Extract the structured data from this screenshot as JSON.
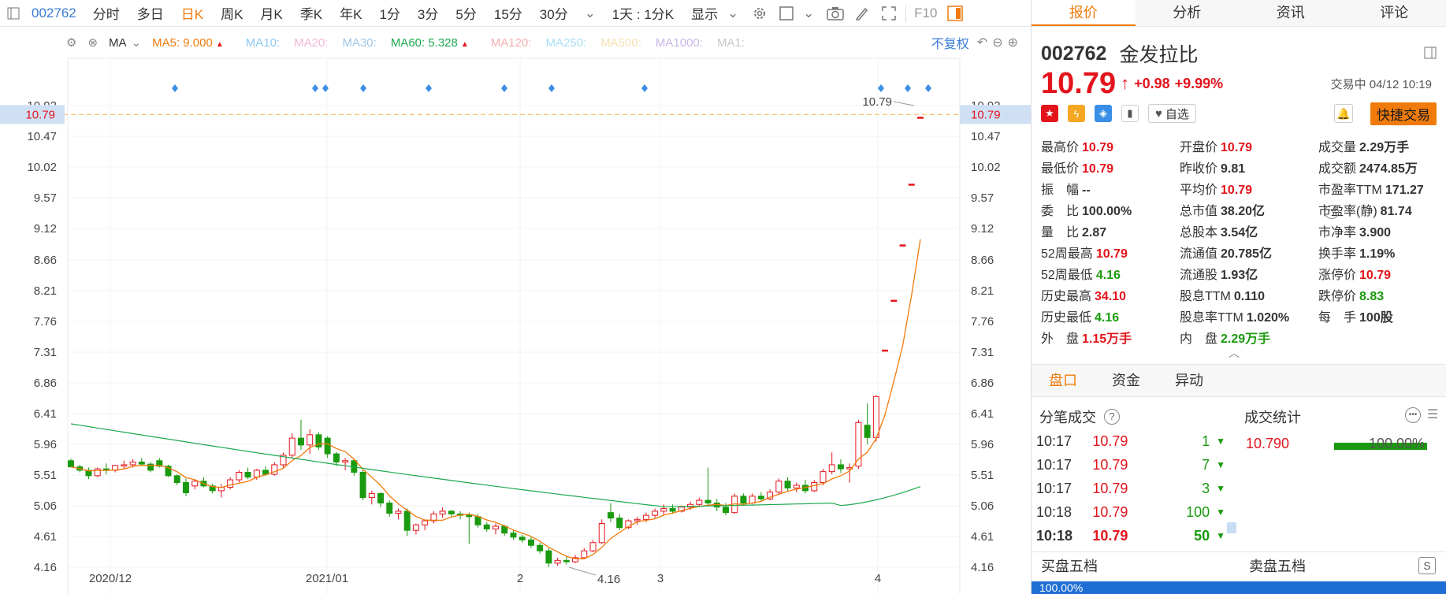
{
  "toolbar": {
    "code": "002762",
    "items": [
      "分时",
      "多日",
      "日K",
      "周K",
      "月K",
      "季K",
      "年K",
      "1分",
      "3分",
      "5分",
      "15分",
      "30分"
    ],
    "active": "日K",
    "kline_setting": "1天 : 1分K",
    "display": "显示",
    "f10": "F10"
  },
  "ma": {
    "label": "MA",
    "items": [
      {
        "text": "MA5: 9.000",
        "color": "#f07b0b",
        "arrow": "up"
      },
      {
        "text": "MA10:",
        "color": "#8ec9f0"
      },
      {
        "text": "MA20:",
        "color": "#f0b7d8"
      },
      {
        "text": "MA30:",
        "color": "#9fc7e6"
      },
      {
        "text": "MA60: 5.328",
        "color": "#1ea84f",
        "arrow": "up"
      },
      {
        "text": "MA120:",
        "color": "#f5b0b0"
      },
      {
        "text": "MA250:",
        "color": "#a8e0f5"
      },
      {
        "text": "MA500:",
        "color": "#f5dfb0"
      },
      {
        "text": "MA1000:",
        "color": "#c8b8e8"
      },
      {
        "text": "MA1:",
        "color": "#c8c8c8"
      }
    ],
    "adjust": "不复权"
  },
  "chart_data": {
    "type": "candlestick",
    "y_ticks": [
      "10.92",
      "10.47",
      "10.02",
      "9.57",
      "9.12",
      "8.66",
      "8.21",
      "7.76",
      "7.31",
      "6.86",
      "6.41",
      "5.96",
      "5.51",
      "5.06",
      "4.61",
      "4.16"
    ],
    "ylim": [
      3.8,
      11.0
    ],
    "x_labels": [
      "2020/12",
      "2021/01",
      "2",
      "3",
      "4"
    ],
    "current_price": "10.79",
    "high_label": "10.79",
    "low_label": "4.16",
    "candles": [
      [
        5.72,
        5.75,
        5.62,
        5.63
      ],
      [
        5.63,
        5.66,
        5.55,
        5.58
      ],
      [
        5.58,
        5.62,
        5.45,
        5.5
      ],
      [
        5.5,
        5.62,
        5.48,
        5.6
      ],
      [
        5.6,
        5.68,
        5.52,
        5.58
      ],
      [
        5.58,
        5.66,
        5.55,
        5.65
      ],
      [
        5.65,
        5.72,
        5.6,
        5.66
      ],
      [
        5.66,
        5.74,
        5.62,
        5.7
      ],
      [
        5.7,
        5.76,
        5.64,
        5.67
      ],
      [
        5.67,
        5.7,
        5.55,
        5.58
      ],
      [
        5.72,
        5.76,
        5.62,
        5.64
      ],
      [
        5.64,
        5.66,
        5.48,
        5.5
      ],
      [
        5.5,
        5.52,
        5.36,
        5.4
      ],
      [
        5.4,
        5.46,
        5.2,
        5.25
      ],
      [
        5.35,
        5.44,
        5.3,
        5.42
      ],
      [
        5.42,
        5.48,
        5.33,
        5.35
      ],
      [
        5.35,
        5.38,
        5.24,
        5.28
      ],
      [
        5.28,
        5.38,
        5.18,
        5.33
      ],
      [
        5.33,
        5.48,
        5.3,
        5.44
      ],
      [
        5.44,
        5.58,
        5.4,
        5.55
      ],
      [
        5.55,
        5.62,
        5.45,
        5.48
      ],
      [
        5.48,
        5.6,
        5.44,
        5.58
      ],
      [
        5.58,
        5.64,
        5.5,
        5.52
      ],
      [
        5.52,
        5.7,
        5.5,
        5.66
      ],
      [
        5.66,
        5.84,
        5.62,
        5.8
      ],
      [
        5.8,
        6.12,
        5.76,
        6.05
      ],
      [
        6.05,
        6.32,
        5.88,
        5.95
      ],
      [
        5.95,
        6.18,
        5.82,
        6.1
      ],
      [
        6.1,
        6.14,
        5.88,
        5.92
      ],
      [
        6.05,
        6.08,
        5.76,
        5.82
      ],
      [
        5.82,
        5.85,
        5.64,
        5.7
      ],
      [
        5.7,
        5.76,
        5.58,
        5.72
      ],
      [
        5.72,
        5.74,
        5.5,
        5.55
      ],
      [
        5.55,
        5.58,
        5.14,
        5.18
      ],
      [
        5.18,
        5.28,
        5.08,
        5.24
      ],
      [
        5.24,
        5.26,
        5.04,
        5.1
      ],
      [
        5.1,
        5.14,
        4.9,
        4.95
      ],
      [
        4.95,
        5.02,
        4.86,
        4.98
      ],
      [
        4.98,
        5.02,
        4.62,
        4.7
      ],
      [
        4.7,
        4.8,
        4.64,
        4.78
      ],
      [
        4.78,
        4.86,
        4.7,
        4.84
      ],
      [
        4.84,
        4.98,
        4.8,
        4.94
      ],
      [
        4.94,
        5.04,
        4.88,
        4.98
      ],
      [
        4.98,
        5.0,
        4.9,
        4.94
      ],
      [
        4.94,
        4.98,
        4.86,
        4.92
      ],
      [
        4.92,
        4.96,
        4.5,
        4.9
      ],
      [
        4.9,
        4.94,
        4.74,
        4.78
      ],
      [
        4.78,
        4.82,
        4.68,
        4.72
      ],
      [
        4.72,
        4.8,
        4.64,
        4.76
      ],
      [
        4.76,
        4.78,
        4.62,
        4.66
      ],
      [
        4.66,
        4.7,
        4.56,
        4.6
      ],
      [
        4.6,
        4.64,
        4.52,
        4.56
      ],
      [
        4.56,
        4.6,
        4.44,
        4.48
      ],
      [
        4.48,
        4.52,
        4.36,
        4.4
      ],
      [
        4.4,
        4.44,
        4.16,
        4.22
      ],
      [
        4.22,
        4.3,
        4.18,
        4.26
      ],
      [
        4.26,
        4.32,
        4.2,
        4.24
      ],
      [
        4.24,
        4.34,
        4.22,
        4.3
      ],
      [
        4.3,
        4.44,
        4.28,
        4.4
      ],
      [
        4.4,
        4.56,
        4.38,
        4.52
      ],
      [
        4.52,
        4.86,
        4.5,
        4.8
      ],
      [
        4.96,
        5.1,
        4.82,
        4.88
      ],
      [
        4.88,
        4.94,
        4.7,
        4.74
      ],
      [
        4.74,
        4.86,
        4.72,
        4.84
      ],
      [
        4.84,
        4.9,
        4.78,
        4.86
      ],
      [
        4.86,
        4.96,
        4.82,
        4.92
      ],
      [
        4.92,
        5.02,
        4.88,
        4.98
      ],
      [
        4.98,
        5.08,
        4.92,
        5.02
      ],
      [
        5.02,
        5.08,
        4.94,
        4.98
      ],
      [
        4.98,
        5.06,
        4.96,
        5.04
      ],
      [
        5.04,
        5.12,
        5.0,
        5.08
      ],
      [
        5.08,
        5.18,
        5.04,
        5.14
      ],
      [
        5.14,
        5.62,
        5.06,
        5.1
      ],
      [
        5.1,
        5.16,
        4.98,
        5.04
      ],
      [
        5.04,
        5.1,
        4.92,
        4.96
      ],
      [
        4.96,
        5.24,
        4.94,
        5.2
      ],
      [
        5.2,
        5.24,
        5.06,
        5.1
      ],
      [
        5.1,
        5.24,
        5.08,
        5.2
      ],
      [
        5.2,
        5.26,
        5.12,
        5.16
      ],
      [
        5.16,
        5.3,
        5.14,
        5.26
      ],
      [
        5.26,
        5.46,
        5.22,
        5.42
      ],
      [
        5.42,
        5.48,
        5.28,
        5.32
      ],
      [
        5.32,
        5.4,
        5.26,
        5.36
      ],
      [
        5.36,
        5.44,
        5.24,
        5.28
      ],
      [
        5.28,
        5.44,
        5.26,
        5.4
      ],
      [
        5.4,
        5.6,
        5.36,
        5.56
      ],
      [
        5.56,
        5.84,
        5.52,
        5.66
      ],
      [
        5.66,
        5.74,
        5.54,
        5.6
      ],
      [
        5.6,
        5.68,
        5.4,
        5.62
      ],
      [
        5.64,
        6.32,
        5.6,
        6.28
      ],
      [
        6.24,
        6.56,
        5.96,
        6.06
      ],
      [
        6.06,
        6.68,
        6.0,
        6.66
      ],
      [
        7.34,
        7.34,
        7.34,
        7.34
      ],
      [
        8.07,
        8.07,
        8.07,
        8.07
      ],
      [
        8.88,
        8.88,
        8.88,
        8.88
      ],
      [
        9.77,
        9.77,
        9.77,
        9.77
      ],
      [
        10.75,
        10.75,
        10.75,
        10.75
      ]
    ],
    "ma60_start": 6.26,
    "ma60_end": 5.34
  },
  "panel": {
    "tabs": [
      "报价",
      "分析",
      "资讯",
      "评论"
    ],
    "active_tab": "报价",
    "code": "002762",
    "name": "金发拉比",
    "price": "10.79",
    "arrow": "↑",
    "change": "+0.98",
    "change_pct": "+9.99%",
    "trade_time": "交易中 04/12 10:19",
    "watch": "自选",
    "quick_trade": "快捷交易",
    "quotes": [
      {
        "label": "最高价",
        "value": "10.79",
        "cls": "red"
      },
      {
        "label": "开盘价",
        "value": "10.79",
        "cls": "red"
      },
      {
        "label": "成交量",
        "value": "2.29万手",
        "cls": "blk"
      },
      {
        "label": "最低价",
        "value": "10.79",
        "cls": "red"
      },
      {
        "label": "昨收价",
        "value": "9.81",
        "cls": "blk"
      },
      {
        "label": "成交额",
        "value": "2474.85万",
        "cls": "blk"
      },
      {
        "label": "振　幅",
        "value": "--",
        "cls": "blk"
      },
      {
        "label": "平均价",
        "value": "10.79",
        "cls": "red"
      },
      {
        "label": "市盈率TTM",
        "value": "171.27",
        "cls": "blk"
      },
      {
        "label": "委　比",
        "value": "100.00%",
        "cls": "blk"
      },
      {
        "label": "总市值",
        "value": "38.20亿",
        "cls": "blk"
      },
      {
        "label": "市盈率(静)",
        "value": "81.74",
        "cls": "blk"
      },
      {
        "label": "量　比",
        "value": "2.87",
        "cls": "blk"
      },
      {
        "label": "总股本",
        "value": "3.54亿",
        "cls": "blk"
      },
      {
        "label": "市净率",
        "value": "3.900",
        "cls": "blk"
      },
      {
        "label": "52周最高",
        "value": "10.79",
        "cls": "red"
      },
      {
        "label": "流通值",
        "value": "20.785亿",
        "cls": "blk"
      },
      {
        "label": "换手率",
        "value": "1.19%",
        "cls": "blk"
      },
      {
        "label": "52周最低",
        "value": "4.16",
        "cls": "green"
      },
      {
        "label": "流通股",
        "value": "1.93亿",
        "cls": "blk"
      },
      {
        "label": "涨停价",
        "value": "10.79",
        "cls": "red"
      },
      {
        "label": "历史最高",
        "value": "34.10",
        "cls": "red"
      },
      {
        "label": "股息TTM",
        "value": "0.110",
        "cls": "blk"
      },
      {
        "label": "跌停价",
        "value": "8.83",
        "cls": "green"
      },
      {
        "label": "历史最低",
        "value": "4.16",
        "cls": "green"
      },
      {
        "label": "股息率TTM",
        "value": "1.020%",
        "cls": "blk"
      },
      {
        "label": "每　手",
        "value": "100股",
        "cls": "blk"
      },
      {
        "label": "外　盘",
        "value": "1.15万手",
        "cls": "red"
      },
      {
        "label": "内　盘",
        "value": "2.29万手",
        "cls": "green"
      },
      {
        "label": "",
        "value": "",
        "cls": "blk"
      }
    ],
    "subtabs": [
      "盘口",
      "资金",
      "异动"
    ],
    "active_subtab": "盘口",
    "ticks_title": "分笔成交",
    "stat_title": "成交统计",
    "ticks": [
      {
        "time": "10:17",
        "price": "10.79",
        "vol": "1"
      },
      {
        "time": "10:17",
        "price": "10.79",
        "vol": "7"
      },
      {
        "time": "10:17",
        "price": "10.79",
        "vol": "3"
      },
      {
        "time": "10:18",
        "price": "10.79",
        "vol": "100"
      },
      {
        "time": "10:18",
        "price": "10.79",
        "vol": "50"
      }
    ],
    "stat_price": "10.790",
    "stat_pct": "100.00%",
    "buy5": "买盘五档",
    "sell5": "卖盘五档",
    "book_pct": "100.00%"
  }
}
